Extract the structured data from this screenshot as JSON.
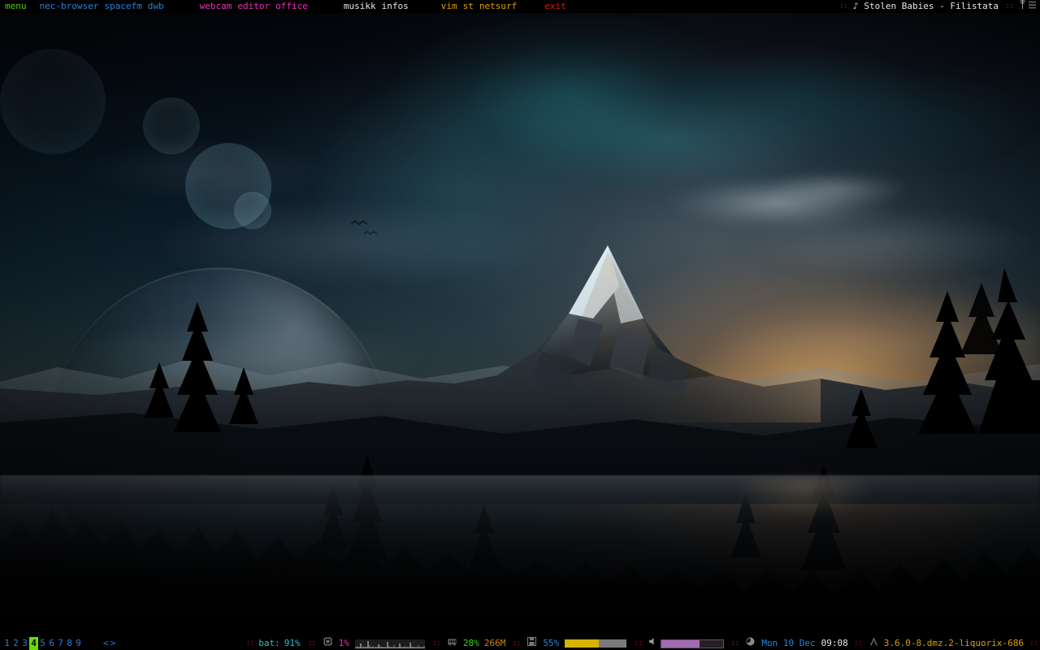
{
  "desktop": {
    "wallpaper_alt": "night mountain peak over lake with aurora and sunset"
  },
  "topbar": {
    "groups": [
      {
        "name": "system",
        "color": "#55cc00",
        "items": [
          {
            "label": "menu",
            "icon": "menu-launcher"
          }
        ]
      },
      {
        "name": "files",
        "color": "#2a7fd4",
        "items": [
          {
            "label": "nec-browser"
          },
          {
            "label": "spacefm"
          },
          {
            "label": "dwb"
          }
        ]
      },
      {
        "name": "media",
        "color": "#e832b4",
        "items": [
          {
            "label": "webcam"
          },
          {
            "label": "editor"
          },
          {
            "label": "office"
          }
        ]
      },
      {
        "name": "info",
        "color": "#e6e6e6",
        "items": [
          {
            "label": "musikk"
          },
          {
            "label": "infos"
          }
        ]
      },
      {
        "name": "terminals",
        "color": "#d8a000",
        "items": [
          {
            "label": "vim"
          },
          {
            "label": "st"
          },
          {
            "label": "netsurf"
          }
        ]
      },
      {
        "name": "session",
        "color": "#cc2200",
        "items": [
          {
            "label": "exit"
          }
        ]
      }
    ],
    "now_playing": {
      "separator": "::",
      "icon": "music-note-icon",
      "text": "Stolen Babies - Filistata"
    },
    "tray": {
      "separator": "::",
      "icon": "signal-tower-icon",
      "bars_icon": "signal-bars-icon"
    }
  },
  "botbar": {
    "workspaces": {
      "items": [
        "1",
        "2",
        "3",
        "4",
        "5",
        "6",
        "7",
        "8",
        "9"
      ],
      "active": "4",
      "active_bg": "#66dd00",
      "inactive_color": "#2a7fd4"
    },
    "layout": {
      "icon": "tile-layout-icon",
      "label": "<>"
    },
    "separator": "::",
    "battery": {
      "icon": "battery-icon",
      "label": "bat:",
      "value": "91%",
      "color": "#22c4d4"
    },
    "cpu": {
      "icon": "cpu-chip-icon",
      "value": "1%",
      "color": "#e832b4",
      "graph": [
        2,
        3,
        2,
        6,
        3,
        2,
        2,
        9,
        4,
        2,
        3,
        2,
        2,
        5,
        3,
        2,
        2,
        2,
        8,
        3,
        2,
        2,
        4,
        2,
        2,
        6,
        2,
        2,
        3,
        2,
        2,
        7,
        3,
        2,
        2,
        2,
        4,
        2,
        2,
        3
      ]
    },
    "memory": {
      "icon": "ram-icon",
      "percent": "28%",
      "used": "266M",
      "percent_color": "#38d018",
      "used_color": "#d08800"
    },
    "disk": {
      "icon": "disk-icon",
      "value": "55%",
      "color": "#1f86e0",
      "fill_percent": 55,
      "fill_color": "#d8b200",
      "track_color": "#7a7a7a"
    },
    "volume": {
      "icon": "speaker-icon",
      "fill_percent": 62,
      "fill_color": "#a06cb0"
    },
    "clock": {
      "icon": "clock-icon",
      "date": "Mon 10 Dec",
      "time": "09:08",
      "date_color": "#1f86e0",
      "time_color": "#e6e6e6"
    },
    "kernel": {
      "icon": "arch-icon",
      "version": "3.6.0-8.dmz.2-liquorix-686",
      "color": "#d8a000"
    }
  }
}
